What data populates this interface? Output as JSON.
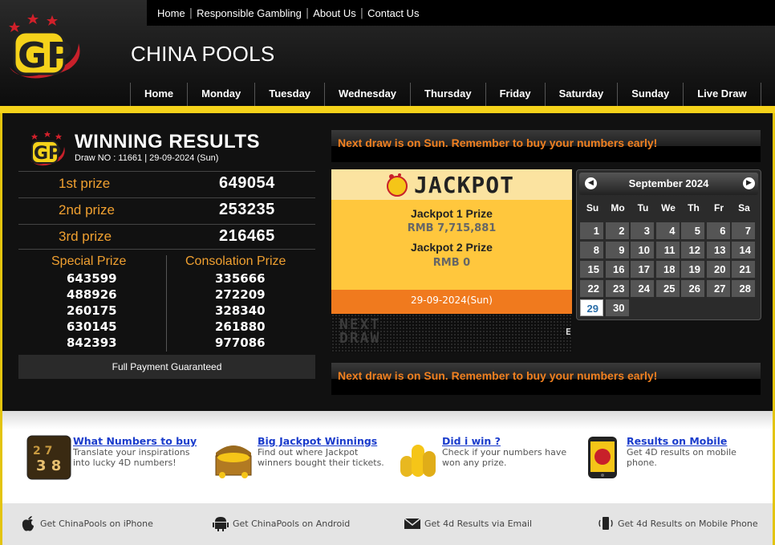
{
  "topnav": [
    "Home",
    "Responsible Gambling",
    "About Us",
    "Contact Us"
  ],
  "brand": "CHINA POOLS",
  "mainnav": [
    "Home",
    "Monday",
    "Tuesday",
    "Wednesday",
    "Thursday",
    "Friday",
    "Saturday",
    "Sunday",
    "Live Draw"
  ],
  "results": {
    "title": "WINNING RESULTS",
    "draw": "Draw NO : 11661 | 29-09-2024 (Sun)",
    "prizes": [
      {
        "label": "1st prize",
        "number": "649054"
      },
      {
        "label": "2nd prize",
        "number": "253235"
      },
      {
        "label": "3rd prize",
        "number": "216465"
      }
    ],
    "special_label": "Special Prize",
    "special": [
      "643599",
      "488926",
      "260175",
      "630145",
      "842393"
    ],
    "consolation_label": "Consolation Prize",
    "consolation": [
      "335666",
      "272209",
      "328340",
      "261880",
      "977086"
    ],
    "guarantee": "Full Payment Guaranteed"
  },
  "notice": "Next draw is on Sun. Remember to buy your numbers early!",
  "jackpot": {
    "header": "JACKPOT",
    "p1_label": "Jackpot 1 Prize",
    "p1_value": "RMB 7,715,881",
    "p2_label": "Jackpot 2 Prize",
    "p2_value": "RMB 0",
    "date": "29-09-2024(Sun)",
    "board_line1": "NEXT",
    "board_line2": "DRAW",
    "board_tail": "E"
  },
  "calendar": {
    "month": "September 2024",
    "dow": [
      "Su",
      "Mo",
      "Tu",
      "We",
      "Th",
      "Fr",
      "Sa"
    ],
    "days": [
      "1",
      "2",
      "3",
      "4",
      "5",
      "6",
      "7",
      "8",
      "9",
      "10",
      "11",
      "12",
      "13",
      "14",
      "15",
      "16",
      "17",
      "18",
      "19",
      "20",
      "21",
      "22",
      "23",
      "24",
      "25",
      "26",
      "27",
      "28",
      "29",
      "30"
    ],
    "today": "29"
  },
  "features": [
    {
      "title": "What Numbers to buy",
      "desc": "Translate your inspirations into lucky 4D numbers!",
      "icon": "numbers-icon"
    },
    {
      "title": "Big Jackpot Winnings",
      "desc": "Find out where Jackpot winners bought their tickets.",
      "icon": "treasure-chest-icon"
    },
    {
      "title": "Did i win ?",
      "desc": "Check if your numbers have won any prize.",
      "icon": "coins-icon"
    },
    {
      "title": "Results on Mobile",
      "desc": "Get 4D results on mobile phone.",
      "icon": "mobile-phone-icon"
    }
  ],
  "footer": [
    {
      "text": "Get ChinaPools on iPhone",
      "icon": "apple-icon"
    },
    {
      "text": "Get ChinaPools on Android",
      "icon": "android-icon"
    },
    {
      "text": "Get 4d Results via Email",
      "icon": "envelope-icon"
    },
    {
      "text": "Get 4d Results on Mobile Phone",
      "icon": "vibrating-phone-icon"
    }
  ]
}
